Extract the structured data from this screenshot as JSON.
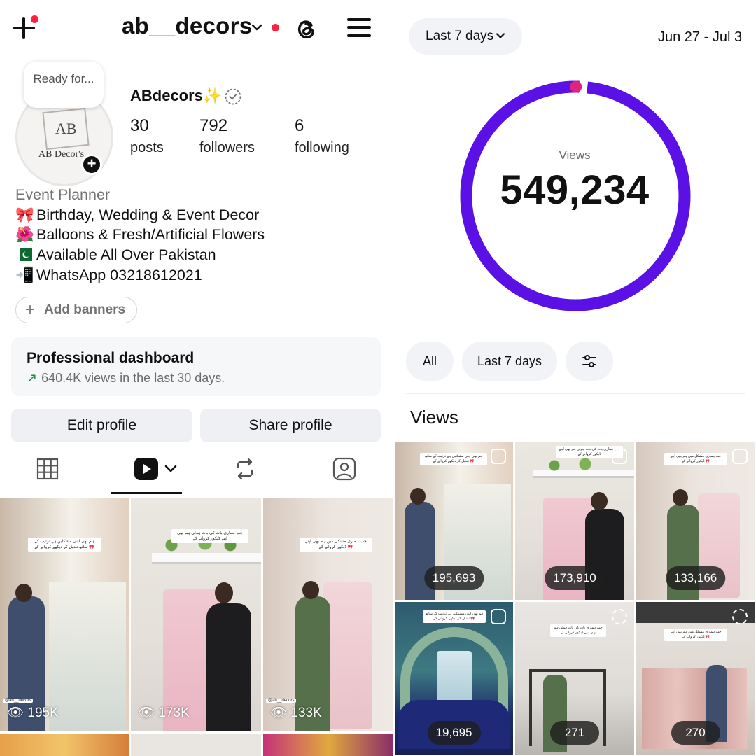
{
  "profile": {
    "username": "ab__decors",
    "display_name": "ABdecors✨",
    "note": "Ready for...",
    "stats": [
      {
        "value": "30",
        "label": "posts"
      },
      {
        "value": "792",
        "label": "followers"
      },
      {
        "value": "6",
        "label": "following"
      }
    ],
    "bio": {
      "category": "Event Planner",
      "lines": [
        {
          "emoji": "🎀",
          "text": "Birthday, Wedding & Event Decor"
        },
        {
          "emoji": "🌺",
          "text": "Balloons & Fresh/Artificial Flowers"
        },
        {
          "emoji": "🇵🇰",
          "text": "Available All Over Pakistan"
        },
        {
          "emoji": "📲",
          "text": "WhatsApp 03218612021"
        }
      ]
    },
    "avatar_logo": {
      "monogram": "AB",
      "name": "AB Decor's"
    },
    "add_banners_label": "Add banners",
    "professional_dashboard": {
      "title": "Professional dashboard",
      "subtitle": "640.4K views in the last 30 days.",
      "trend_icon": "trend-up-arrow-icon"
    },
    "buttons": {
      "edit": "Edit profile",
      "share": "Share profile"
    },
    "tabs": [
      "grid-icon",
      "reels-icon",
      "reposts-icon",
      "tagged-icon"
    ],
    "active_tab": "reels",
    "reels": [
      {
        "views": "195K",
        "handle": "@ab__decors",
        "caption": "ہم بھی اپنی مشکلیں ہے ترتیب کے ساتھ تبدیل کر دیکھے کروانے کے 🎀"
      },
      {
        "views": "173K",
        "handle": "",
        "caption": "جب ہماری بات کی بات ہوئی ہم بھی اپنے ڈیکور کروانے کے"
      },
      {
        "views": "133K",
        "handle": "@ab__decors",
        "caption": "جب ہماری مشکل میں ہم بھی اپنے ڈیکور کروانے کے 🎀"
      }
    ]
  },
  "insights": {
    "range_label": "Last 7 days",
    "date_range": "Jun 27 - Jul 3",
    "metric_label": "Views",
    "metric_value": "549,234",
    "ring_color": "#5b10e6",
    "ring_accent": "#e0237d",
    "filters": [
      "All",
      "Last 7 days",
      "sliders-icon"
    ],
    "section_heading": "Views",
    "reels": [
      {
        "views": "195,693"
      },
      {
        "views": "173,910"
      },
      {
        "views": "133,166"
      },
      {
        "views": "19,695"
      },
      {
        "views": "271"
      },
      {
        "views": "270"
      }
    ]
  },
  "colors": {
    "red_badge": "#ff1f3f",
    "trend_green": "#1e8a3a",
    "muted": "#737373"
  }
}
